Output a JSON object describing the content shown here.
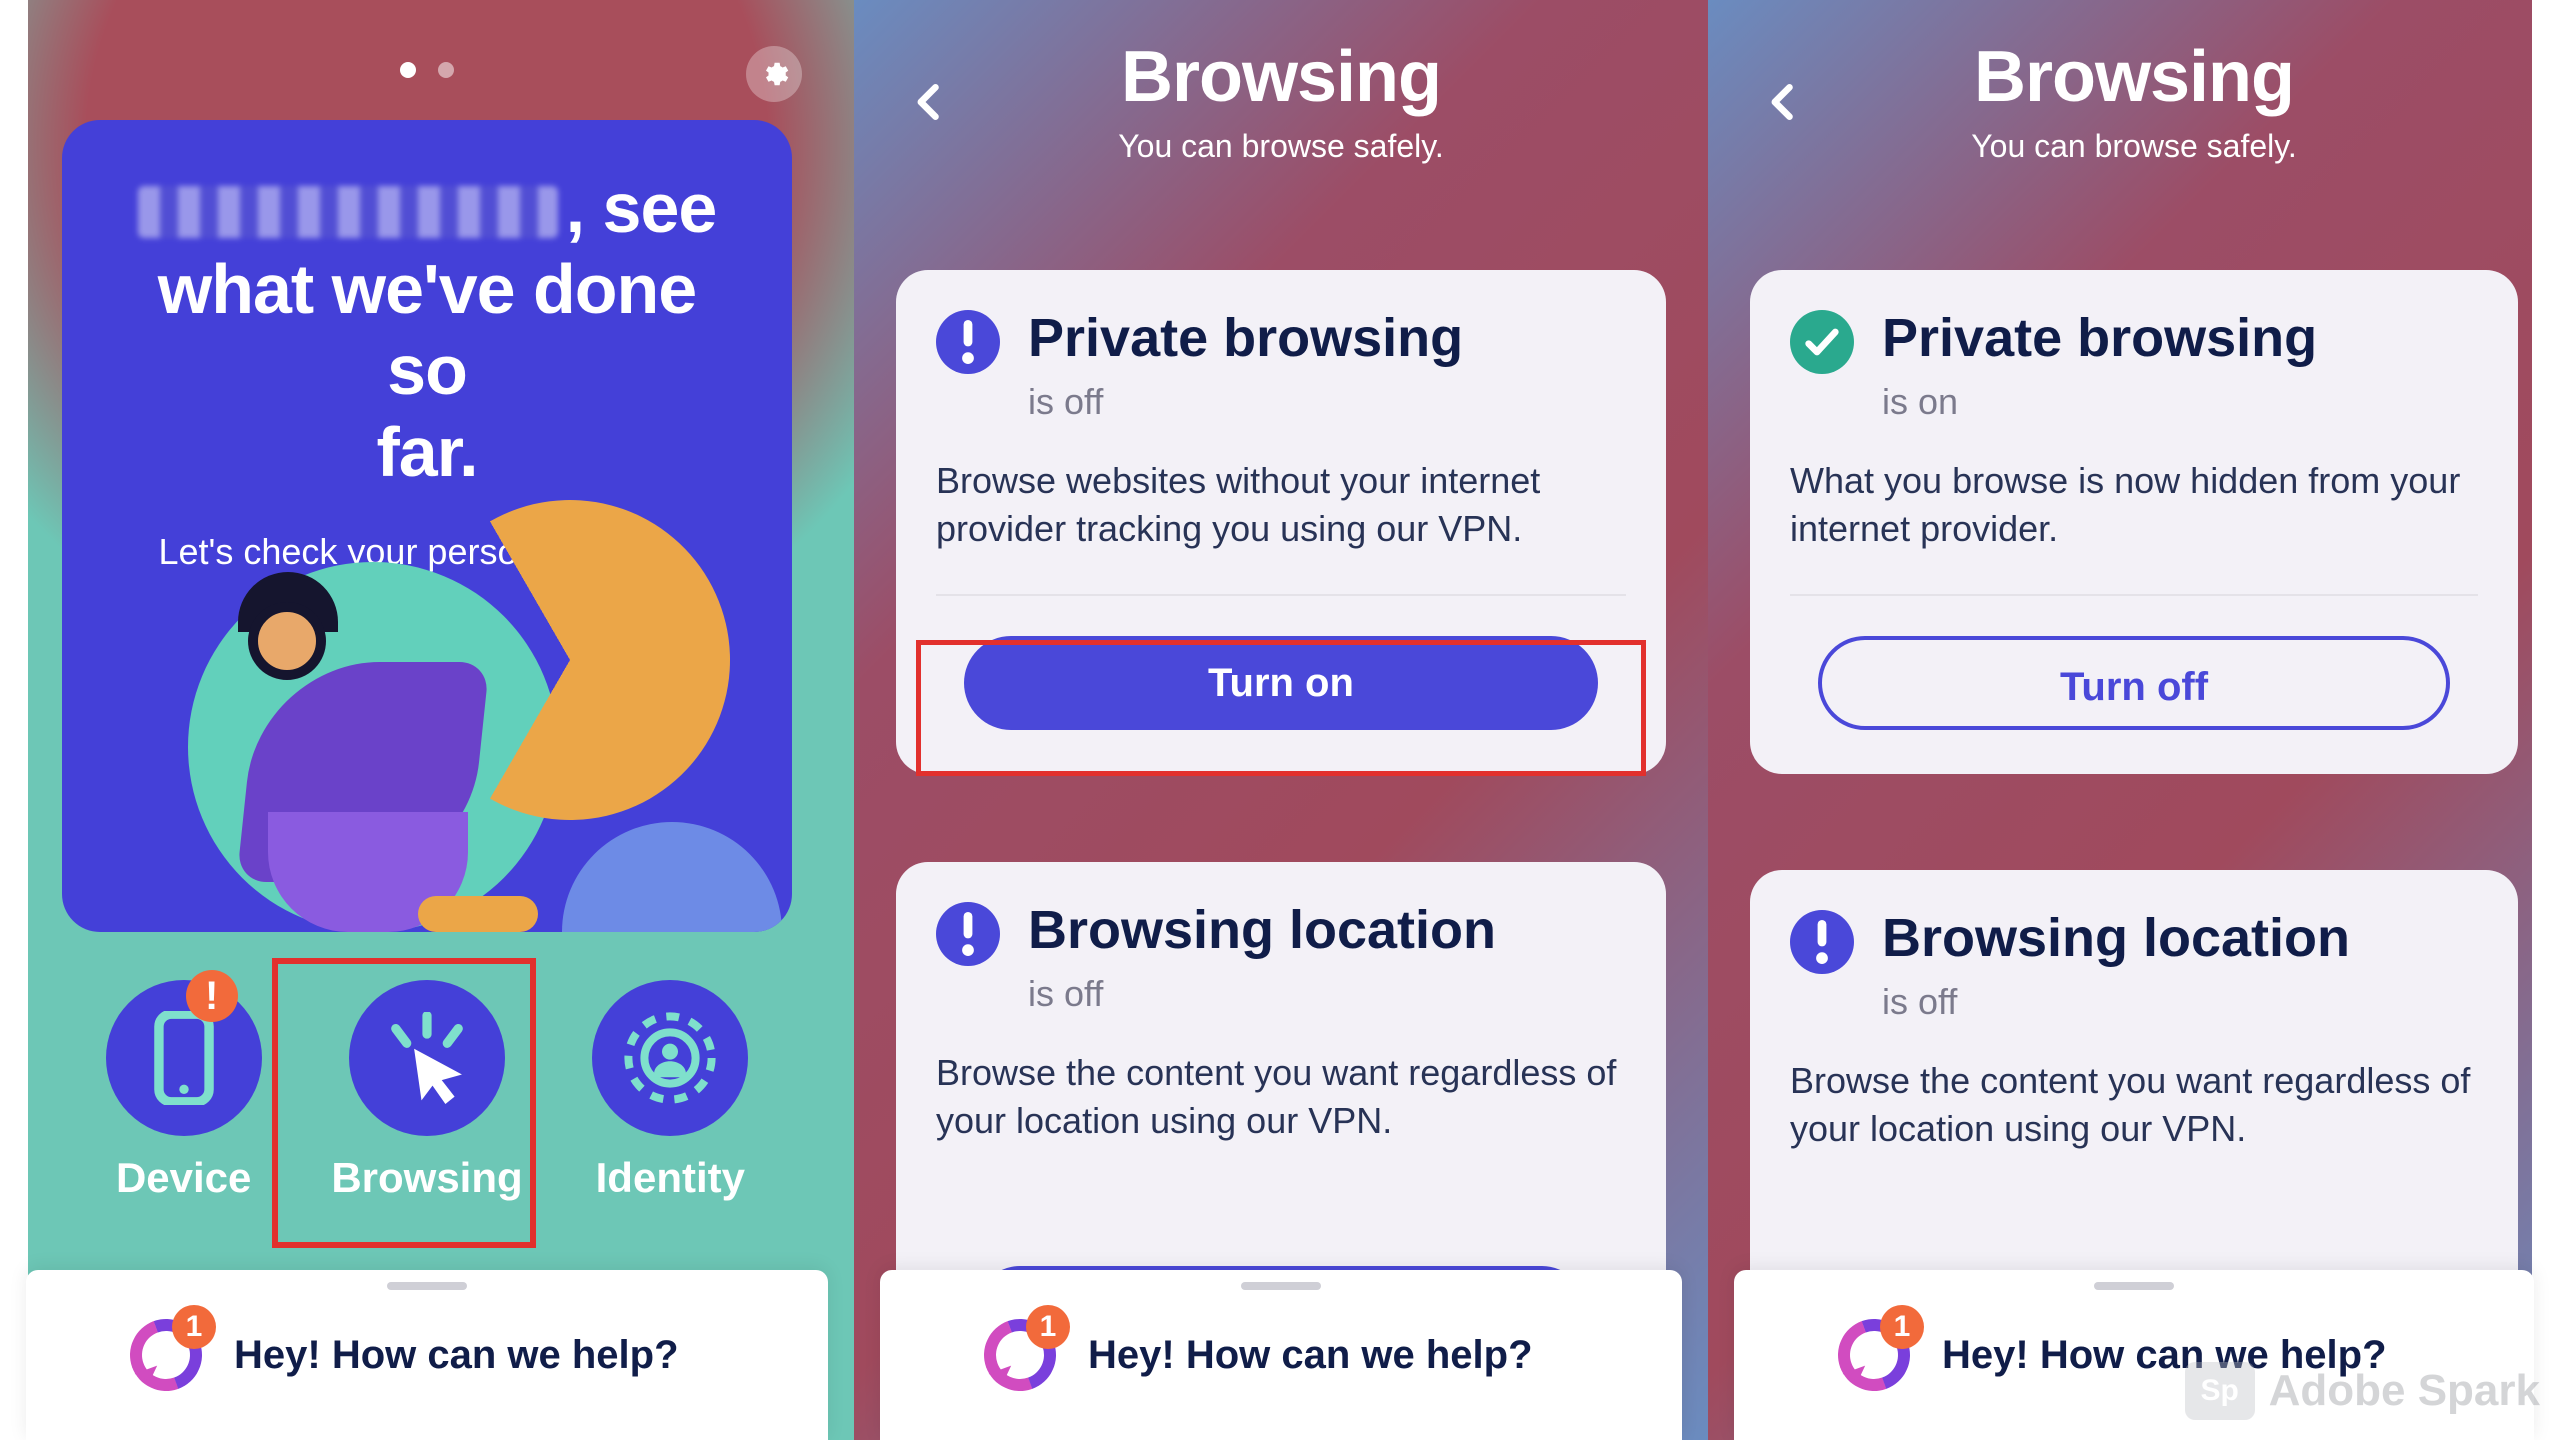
{
  "colors": {
    "accent": "#4a48d9",
    "teal": "#62d0bb",
    "orange": "#f26a3b"
  },
  "panel1": {
    "hero_before_name_obscured": true,
    "hero_line1_tail": ", see",
    "hero_line2": "what we've done so",
    "hero_line3": "far.",
    "hero_sub": "Let's check your personal stats",
    "hero_sub_arrow": "→",
    "nav": {
      "device": "Device",
      "browsing": "Browsing",
      "identity": "Identity"
    },
    "device_badge": "!",
    "pager": {
      "count": 2,
      "active": 0
    }
  },
  "panel2": {
    "title": "Browsing",
    "subtitle": "You can browse safely.",
    "cardA": {
      "icon": "alert",
      "title": "Private browsing",
      "status": "is off",
      "desc": "Browse websites without your internet provider tracking you using our VPN.",
      "button": "Turn on"
    },
    "cardB": {
      "icon": "alert",
      "title": "Browsing location",
      "status": "is off",
      "desc": "Browse the content you want regardless of your location using our VPN."
    }
  },
  "panel3": {
    "title": "Browsing",
    "subtitle": "You can browse safely.",
    "cardA": {
      "icon": "ok",
      "title": "Private browsing",
      "status": "is on",
      "desc": "What you browse is now hidden from your internet provider.",
      "button": "Turn off"
    },
    "cardB": {
      "icon": "alert",
      "title": "Browsing location",
      "status": "is off",
      "desc": "Browse the content you want regardless of your location using our VPN."
    }
  },
  "chat": {
    "text": "Hey! How can we help?",
    "badge": "1"
  },
  "watermark": {
    "logo": "Sp",
    "text": "Adobe Spark"
  }
}
